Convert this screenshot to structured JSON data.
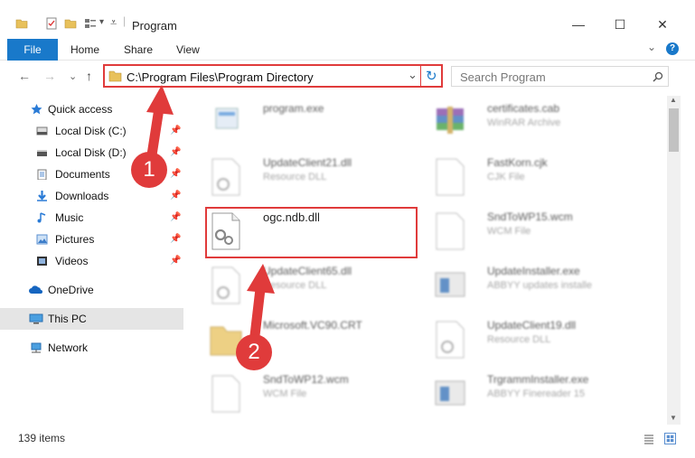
{
  "window": {
    "title": "Program",
    "minimize": "—",
    "maximize": "☐",
    "close": "✕"
  },
  "ribbon": {
    "file": "File",
    "tabs": [
      "Home",
      "Share",
      "View"
    ],
    "help": "?",
    "expand": "⌄"
  },
  "nav": {
    "back": "←",
    "forward": "→",
    "history": "⌄",
    "up": "↑"
  },
  "address": {
    "path": "C:\\Program Files\\Program Directory",
    "dropdown": "⌄",
    "refresh": "↻"
  },
  "search": {
    "placeholder": "Search Program",
    "icon": "search-icon"
  },
  "sidebar": {
    "quick_access": "Quick access",
    "items": [
      {
        "label": "Local Disk (C:)",
        "icon": "drive-icon",
        "pinned": true
      },
      {
        "label": "Local Disk (D:)",
        "icon": "drive-icon",
        "pinned": true
      },
      {
        "label": "Documents",
        "icon": "documents-icon",
        "pinned": true
      },
      {
        "label": "Downloads",
        "icon": "downloads-icon",
        "pinned": true
      },
      {
        "label": "Music",
        "icon": "music-icon",
        "pinned": true
      },
      {
        "label": "Pictures",
        "icon": "pictures-icon",
        "pinned": true
      },
      {
        "label": "Videos",
        "icon": "videos-icon",
        "pinned": true
      }
    ],
    "onedrive": "OneDrive",
    "this_pc": "This PC",
    "network": "Network"
  },
  "files": {
    "left": [
      {
        "name": "program.exe",
        "type": ""
      },
      {
        "name": "UpdateClient21.dll",
        "type": "Resource DLL"
      },
      {
        "name": "ogc.ndb.dll",
        "type": ""
      },
      {
        "name": "UpdateClient65.dll",
        "type": "Resource DLL"
      },
      {
        "name": "Microsoft.VC90.CRT",
        "type": ""
      },
      {
        "name": "SndToWP12.wcm",
        "type": "WCM File"
      }
    ],
    "right": [
      {
        "name": "certificates.cab",
        "type": "WinRAR Archive"
      },
      {
        "name": "FastKorn.cjk",
        "type": "CJK File"
      },
      {
        "name": "SndToWP15.wcm",
        "type": "WCM File"
      },
      {
        "name": "UpdateInstaller.exe",
        "type": "ABBYY updates installe"
      },
      {
        "name": "UpdateClient19.dll",
        "type": "Resource DLL"
      },
      {
        "name": "TrgrammInstaller.exe",
        "type": "ABBYY Finereader 15"
      }
    ]
  },
  "status": {
    "count": "139 items"
  },
  "annotations": {
    "step1": "1",
    "step2": "2"
  },
  "colors": {
    "accent": "#1979ca",
    "highlight": "#e03b3b",
    "selected": "#e5f1fb"
  }
}
